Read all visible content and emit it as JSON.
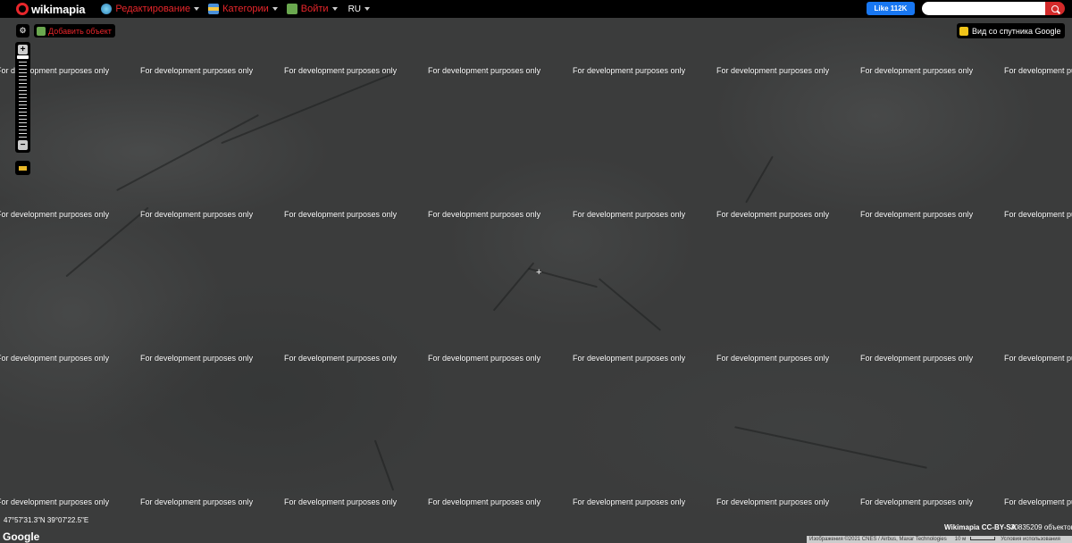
{
  "header": {
    "logo_text": "wikimapia",
    "menu": [
      {
        "label": "Редактирование",
        "icon": "globe-icon"
      },
      {
        "label": "Категории",
        "icon": "categories-icon"
      },
      {
        "label": "Войти",
        "icon": "login-icon"
      }
    ],
    "lang": "RU",
    "fb_like": "Like 112K",
    "search": {
      "value": "",
      "placeholder": ""
    }
  },
  "map": {
    "add_object": "Добавить объект",
    "satellite_label": "Вид со спутника Google",
    "watermark": "For development purposes only",
    "coords": "47°57'31.3\"N 39°07'22.5\"E",
    "google": "Google",
    "credit": "Wikimapia CC-BY-SA",
    "count": "30835209 объектов",
    "attribution": "Изображения ©2021 CNES / Airbus, Maxar Technologies",
    "scale": "10 м",
    "terms": "Условия использования"
  },
  "colors": {
    "accent": "#e8262b",
    "fb": "#1877f2",
    "search_btn": "#d32a2a"
  }
}
